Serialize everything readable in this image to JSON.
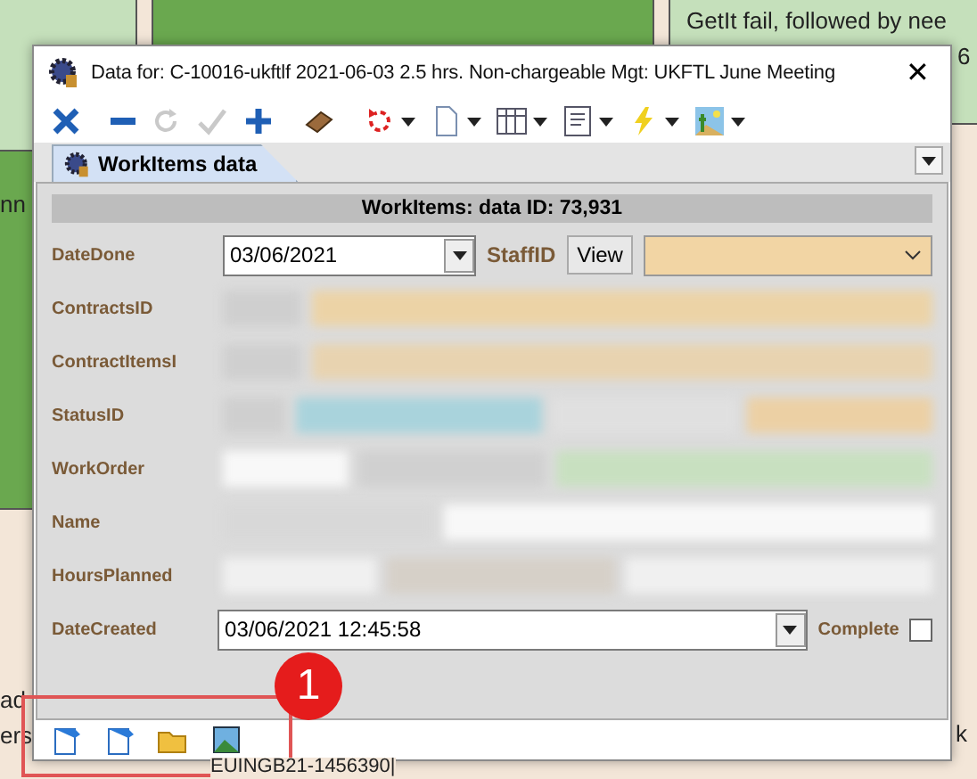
{
  "background": {
    "texts": [
      "GetIt fail, followed by nee",
      "6",
      "nn",
      "ad",
      "ers",
      "k",
      "EUINGB21-1456390|"
    ]
  },
  "window": {
    "title": "Data for: C-10016-ukftlf 2021-06-03 2.5 hrs. Non-chargeable Mgt: UKFTL June Meeting",
    "close": "✕"
  },
  "toolbar": [
    {
      "kind": "x",
      "dropdown": false,
      "disabled": false
    },
    {
      "kind": "minus",
      "dropdown": false,
      "disabled": false
    },
    {
      "kind": "redo",
      "dropdown": false,
      "disabled": true
    },
    {
      "kind": "check",
      "dropdown": false,
      "disabled": true
    },
    {
      "kind": "plus",
      "dropdown": false,
      "disabled": false
    },
    {
      "kind": "eraser",
      "dropdown": false,
      "disabled": false
    },
    {
      "kind": "undo",
      "dropdown": true,
      "disabled": false
    },
    {
      "kind": "page",
      "dropdown": true,
      "disabled": false
    },
    {
      "kind": "grid",
      "dropdown": true,
      "disabled": false
    },
    {
      "kind": "form",
      "dropdown": true,
      "disabled": false
    },
    {
      "kind": "bolt",
      "dropdown": true,
      "disabled": false
    },
    {
      "kind": "image",
      "dropdown": true,
      "disabled": false
    }
  ],
  "tabs": [
    {
      "label": "WorkItems data",
      "selected": true
    }
  ],
  "header": "WorkItems: data ID: 73,931",
  "fields": [
    {
      "label": "DateDone",
      "kind": "date",
      "value": "03/06/2021",
      "extra_label": "StaffID",
      "extra_button": "View"
    },
    {
      "label": "ContractsID",
      "kind": "blurred"
    },
    {
      "label": "ContractItemsI",
      "kind": "blurred"
    },
    {
      "label": "StatusID",
      "kind": "blurred"
    },
    {
      "label": "WorkOrder",
      "kind": "blurred"
    },
    {
      "label": "Name",
      "kind": "blurred"
    },
    {
      "label": "HoursPlanned",
      "kind": "blurred"
    },
    {
      "label": "DateCreated",
      "kind": "datetime",
      "value": "03/06/2021 12:45:58",
      "extra_label": "Complete",
      "checked": false
    }
  ],
  "bottom_toolbar": [
    {
      "kind": "note"
    },
    {
      "kind": "note"
    },
    {
      "kind": "folder"
    },
    {
      "kind": "picture"
    }
  ],
  "callout": {
    "number": "1"
  }
}
